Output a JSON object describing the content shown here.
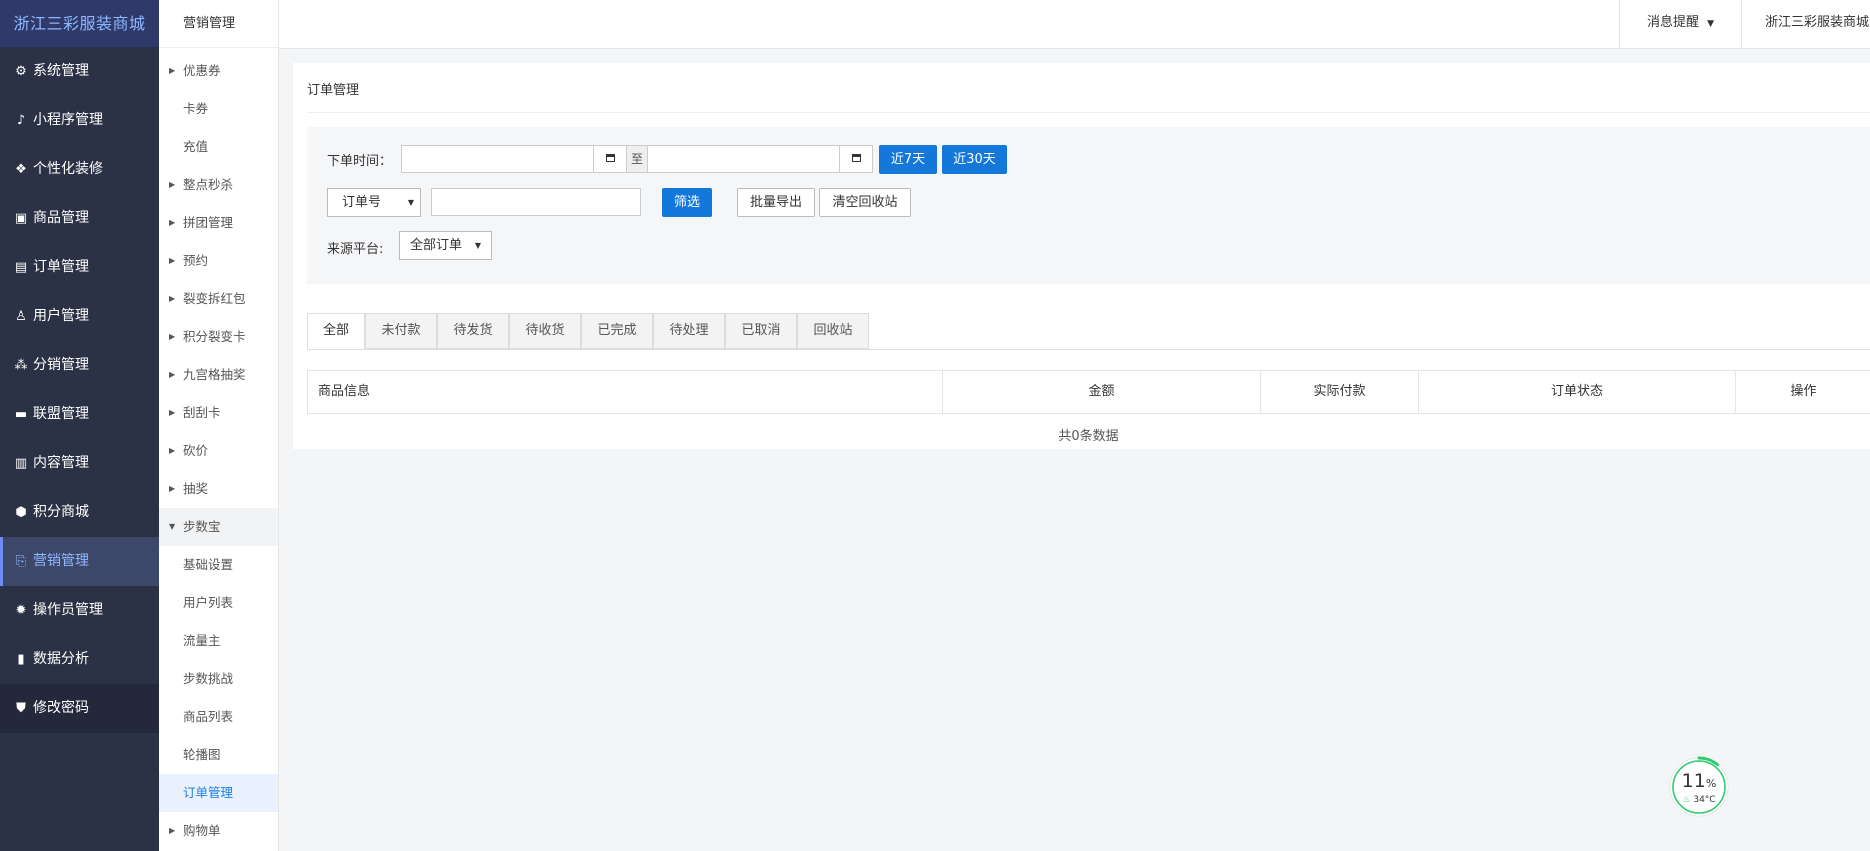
{
  "brand": "浙江三彩服装商城",
  "sidebar": {
    "items": [
      {
        "label": "系统管理",
        "icon": "gear-icon",
        "glyph": "⚙"
      },
      {
        "label": "小程序管理",
        "icon": "mini-program-icon",
        "glyph": "♪"
      },
      {
        "label": "个性化装修",
        "icon": "decoration-icon",
        "glyph": "❖"
      },
      {
        "label": "商品管理",
        "icon": "bag-icon",
        "glyph": "▣"
      },
      {
        "label": "订单管理",
        "icon": "order-icon",
        "glyph": "▤"
      },
      {
        "label": "用户管理",
        "icon": "user-icon",
        "glyph": "♙"
      },
      {
        "label": "分销管理",
        "icon": "distribution-icon",
        "glyph": "⁂"
      },
      {
        "label": "联盟管理",
        "icon": "alliance-icon",
        "glyph": "▬"
      },
      {
        "label": "内容管理",
        "icon": "content-icon",
        "glyph": "▥"
      },
      {
        "label": "积分商城",
        "icon": "cube-icon",
        "glyph": "⬢"
      },
      {
        "label": "营销管理",
        "icon": "marketing-icon",
        "glyph": "⎘"
      },
      {
        "label": "操作员管理",
        "icon": "cog-icon",
        "glyph": "✹"
      },
      {
        "label": "数据分析",
        "icon": "chart-icon",
        "glyph": "▮"
      },
      {
        "label": "修改密码",
        "icon": "shield-icon",
        "glyph": "⛊"
      }
    ]
  },
  "subsidebar": {
    "title": "营销管理",
    "items": [
      {
        "label": "优惠券",
        "caret": "▶"
      },
      {
        "label": "卡券",
        "caret": ""
      },
      {
        "label": "充值",
        "caret": ""
      },
      {
        "label": "整点秒杀",
        "caret": "▶"
      },
      {
        "label": "拼团管理",
        "caret": "▶"
      },
      {
        "label": "预约",
        "caret": "▶"
      },
      {
        "label": "裂变拆红包",
        "caret": "▶"
      },
      {
        "label": "积分裂变卡",
        "caret": "▶"
      },
      {
        "label": "九宫格抽奖",
        "caret": "▶"
      },
      {
        "label": "刮刮卡",
        "caret": "▶"
      },
      {
        "label": "砍价",
        "caret": "▶"
      },
      {
        "label": "抽奖",
        "caret": "▶"
      },
      {
        "label": "步数宝",
        "caret": "▼"
      },
      {
        "label": "基础设置",
        "caret": ""
      },
      {
        "label": "用户列表",
        "caret": ""
      },
      {
        "label": "流量主",
        "caret": ""
      },
      {
        "label": "步数挑战",
        "caret": ""
      },
      {
        "label": "商品列表",
        "caret": ""
      },
      {
        "label": "轮播图",
        "caret": ""
      },
      {
        "label": "订单管理",
        "caret": ""
      },
      {
        "label": "购物单",
        "caret": "▶"
      }
    ]
  },
  "topbar": {
    "message_label": "消息提醒",
    "shop_name": "浙江三彩服装商城"
  },
  "panel": {
    "title": "订单管理",
    "filter": {
      "order_time_label": "下单时间：",
      "date_start_value": "",
      "to_label": "至",
      "date_end_value": "",
      "last7_label": "近7天",
      "last30_label": "近30天",
      "search_type_value": "订单号",
      "keyword_value": "",
      "filter_button": "筛选",
      "export_button": "批量导出",
      "clear_recycle_button": "清空回收站",
      "source_label": "来源平台:",
      "source_value": "全部订单"
    },
    "tabs": [
      "全部",
      "未付款",
      "待发货",
      "待收货",
      "已完成",
      "待处理",
      "已取消",
      "回收站"
    ],
    "table": {
      "columns": [
        "商品信息",
        "金额",
        "实际付款",
        "订单状态",
        "操作"
      ],
      "empty_text": "共0条数据"
    }
  },
  "monitor": {
    "percent": "11",
    "percent_unit": "%",
    "temp": "34°C",
    "level": 0.11
  },
  "colors": {
    "sidebar_bg": "#2c3246",
    "brand_bg": "#2f3a6a",
    "accent_blue": "#1378d9",
    "active_text": "#8fb7ff",
    "monitor_green": "#2ecc71"
  }
}
